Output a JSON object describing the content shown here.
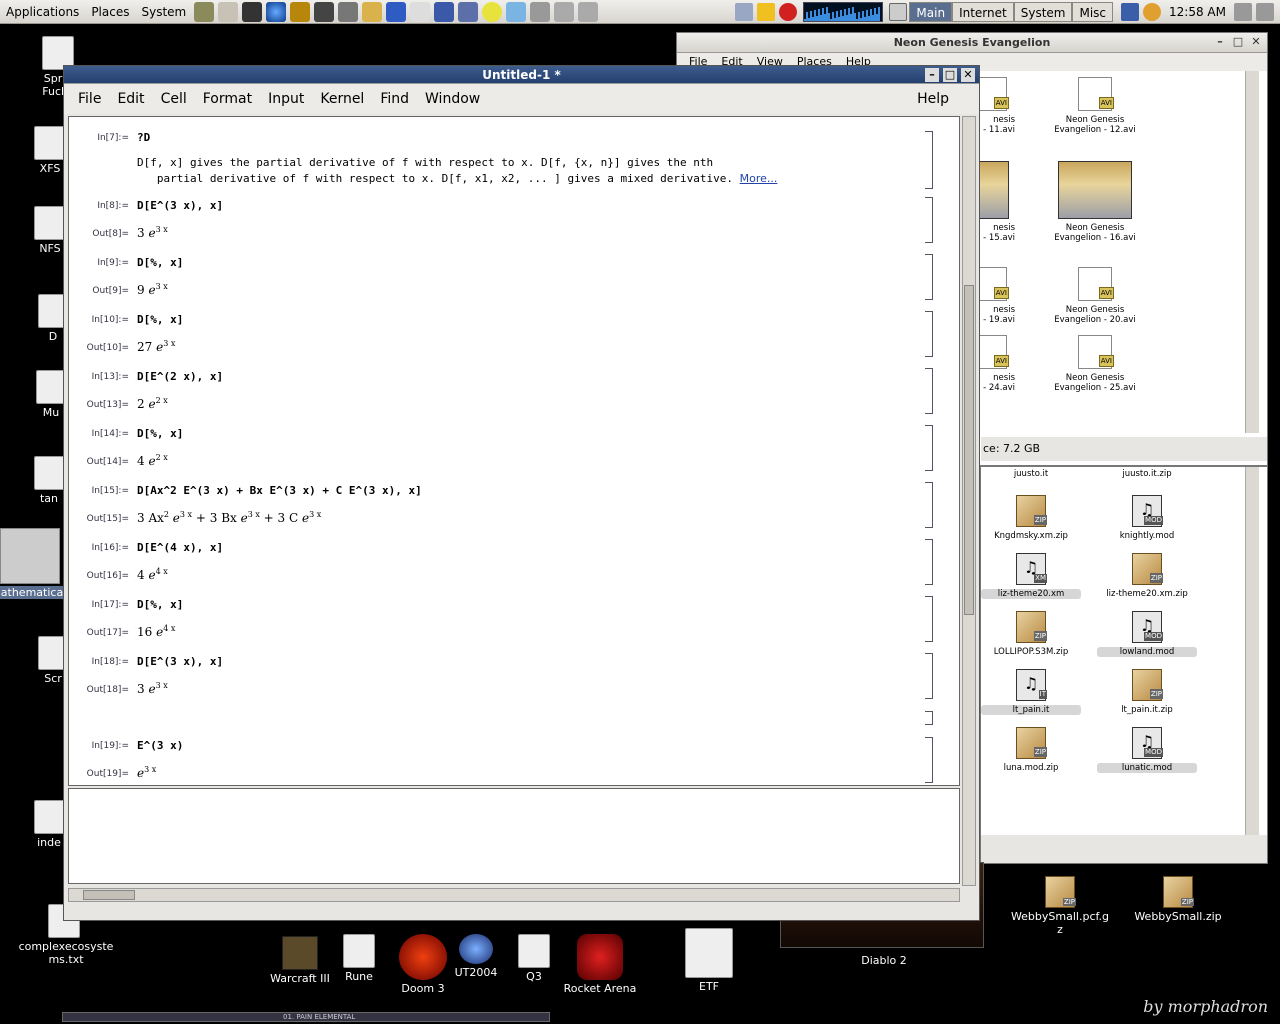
{
  "panel": {
    "menus": [
      "Applications",
      "Places",
      "System"
    ],
    "workspaces": [
      "Main",
      "Internet",
      "System",
      "Misc"
    ],
    "clock": "12:58 AM"
  },
  "desktop_icons": [
    {
      "label": "Sprin\nFucke"
    },
    {
      "label": "XFS"
    },
    {
      "label": "NFS"
    },
    {
      "label": "D"
    },
    {
      "label": "Mu"
    },
    {
      "label": "tan"
    },
    {
      "label": "athematica"
    },
    {
      "label": "Scr"
    },
    {
      "label": "inde"
    },
    {
      "label": "complexecosyste\nms.txt"
    }
  ],
  "file_window": {
    "title": "Neon Genesis Evangelion",
    "menus": [
      "File",
      "Edit",
      "View",
      "Places",
      "Help"
    ],
    "status": "ce: 7.2 GB",
    "items": [
      {
        "name": "nesis\n- 11.avi"
      },
      {
        "name": "Neon Genesis\nEvangelion - 12.avi"
      },
      {
        "name": "nesis\n- 15.avi"
      },
      {
        "name": "Neon Genesis\nEvangelion - 16.avi"
      },
      {
        "name": "nesis\n- 19.avi"
      },
      {
        "name": "Neon Genesis\nEvangelion - 20.avi"
      },
      {
        "name": "nesis\n- 24.avi"
      },
      {
        "name": "Neon Genesis\nEvangelion - 25.avi"
      }
    ]
  },
  "file_window2": {
    "items": [
      {
        "name": "juusto.it"
      },
      {
        "name": "juusto.it.zip"
      },
      {
        "name": "Kngdmsky.xm.zip"
      },
      {
        "name": "knightly.mod"
      },
      {
        "name": "liz-theme20.xm"
      },
      {
        "name": "liz-theme20.xm.zip"
      },
      {
        "name": "LOLLIPOP.S3M.zip"
      },
      {
        "name": "lowland.mod"
      },
      {
        "name": "lt_pain.it"
      },
      {
        "name": "lt_pain.it.zip"
      },
      {
        "name": "luna.mod.zip"
      },
      {
        "name": "lunatic.mod"
      }
    ]
  },
  "mathematica": {
    "title": "Untitled-1 *",
    "menus": [
      "File",
      "Edit",
      "Cell",
      "Format",
      "Input",
      "Kernel",
      "Find",
      "Window"
    ],
    "help": "Help",
    "cells": [
      {
        "in_label": "In[7]:=",
        "input": "?D",
        "doc1": "D[f, x] gives the partial derivative of f with respect to x. D[f, {x, n}] gives the nth",
        "doc2": "   partial derivative of f with respect to x. D[f, x1, x2, ... ] gives a mixed derivative.",
        "more": "More..."
      },
      {
        "in_label": "In[8]:=",
        "input": "D[E^(3 x), x]",
        "out_label": "Out[8]=",
        "output": "3 ℯ",
        "sup": "3 x"
      },
      {
        "in_label": "In[9]:=",
        "input": "D[%, x]",
        "out_label": "Out[9]=",
        "output": "9 ℯ",
        "sup": "3 x"
      },
      {
        "in_label": "In[10]:=",
        "input": "D[%, x]",
        "out_label": "Out[10]=",
        "output": "27 ℯ",
        "sup": "3 x"
      },
      {
        "in_label": "In[13]:=",
        "input": "D[E^(2 x), x]",
        "out_label": "Out[13]=",
        "output": "2 ℯ",
        "sup": "2 x"
      },
      {
        "in_label": "In[14]:=",
        "input": "D[%, x]",
        "out_label": "Out[14]=",
        "output": "4 ℯ",
        "sup": "2 x"
      },
      {
        "in_label": "In[15]:=",
        "input": "D[Ax^2 E^(3 x) + Bx E^(3 x) + C E^(3 x), x]",
        "out_label": "Out[15]=",
        "output_rich": "3 Ax<sup>2</sup> ℯ<sup>3 x</sup> + 3 Bx ℯ<sup>3 x</sup> + 3 C ℯ<sup>3 x</sup>"
      },
      {
        "in_label": "In[16]:=",
        "input": "D[E^(4 x), x]",
        "out_label": "Out[16]=",
        "output": "4 ℯ",
        "sup": "4 x"
      },
      {
        "in_label": "In[17]:=",
        "input": "D[%, x]",
        "out_label": "Out[17]=",
        "output": "16 ℯ",
        "sup": "4 x"
      },
      {
        "in_label": "In[18]:=",
        "input": "D[E^(3 x), x]",
        "out_label": "Out[18]=",
        "output": "3 ℯ",
        "sup": "3 x"
      },
      {
        "in_label": "In[19]:=",
        "input": "E^(3 x)",
        "out_label": "Out[19]=",
        "output": "ℯ",
        "sup": "3 x"
      }
    ]
  },
  "dock": [
    {
      "label": "Warcraft III"
    },
    {
      "label": "Rune"
    },
    {
      "label": "Doom 3"
    },
    {
      "label": "UT2004"
    },
    {
      "label": "Q3"
    },
    {
      "label": "Rocket Arena"
    },
    {
      "label": "ETF"
    },
    {
      "label": "Diablo 2"
    },
    {
      "label": "WebbySmall.pcf.g\nz"
    },
    {
      "label": "WebbySmall.zip"
    }
  ],
  "bottom_bar_text": "01. PAIN ELEMENTAL",
  "signature": "by morphadron",
  "colors": {
    "title_active": "#23406f",
    "link": "#2244aa",
    "workspace_active": "#5a6f8f"
  }
}
